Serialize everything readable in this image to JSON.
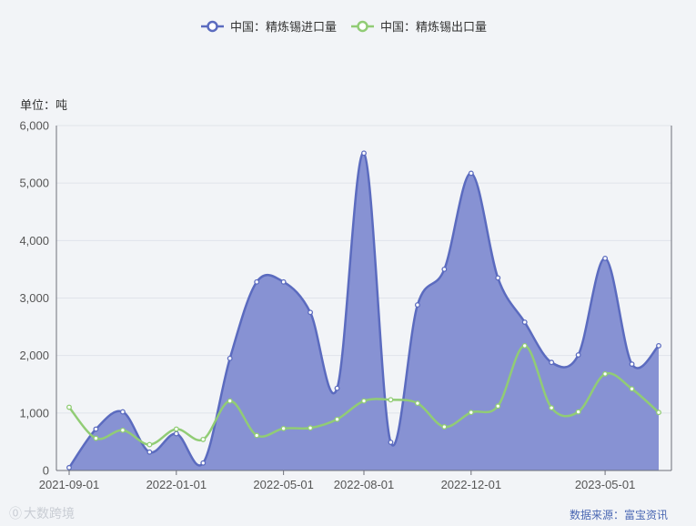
{
  "legend": {
    "items": [
      {
        "label": "中国：精炼锡进口量",
        "color": "#5b6bbf"
      },
      {
        "label": "中国：精炼锡出口量",
        "color": "#91cc75"
      }
    ]
  },
  "unit_label": "单位：吨",
  "source_label": "数据来源：富宝资讯",
  "watermark": "大数跨境",
  "chart_data": {
    "type": "area",
    "x": [
      "2021-09-01",
      "2021-10-01",
      "2021-11-01",
      "2021-12-01",
      "2022-01-01",
      "2022-02-01",
      "2022-03-01",
      "2022-04-01",
      "2022-05-01",
      "2022-06-01",
      "2022-07-01",
      "2022-08-01",
      "2022-09-01",
      "2022-10-01",
      "2022-11-01",
      "2022-12-01",
      "2023-01-01",
      "2023-02-01",
      "2023-03-01",
      "2023-04-01",
      "2023-05-01",
      "2023-06-01",
      "2023-07-01"
    ],
    "xticks": [
      "2021-09-01",
      "2022-01-01",
      "2022-05-01",
      "2022-08-01",
      "2022-12-01",
      "2023-05-01"
    ],
    "ylim": [
      0,
      6000
    ],
    "yticks": [
      "0",
      "1,000",
      "2,000",
      "3,000",
      "4,000",
      "5,000",
      "6,000"
    ],
    "series": [
      {
        "name": "中国：精炼锡进口量",
        "color": "#5b6bbf",
        "fill": "#8792d3",
        "values": [
          50,
          720,
          1020,
          320,
          640,
          130,
          1950,
          3280,
          3280,
          2750,
          1430,
          5520,
          490,
          2880,
          3500,
          5170,
          3350,
          2580,
          1880,
          2010,
          3690,
          1850,
          2170
        ]
      },
      {
        "name": "中国：精炼锡出口量",
        "color": "#91cc75",
        "values": [
          1100,
          560,
          700,
          450,
          720,
          540,
          1210,
          610,
          730,
          740,
          890,
          1210,
          1230,
          1170,
          760,
          1010,
          1120,
          2170,
          1090,
          1020,
          1680,
          1420,
          1010
        ]
      }
    ]
  }
}
